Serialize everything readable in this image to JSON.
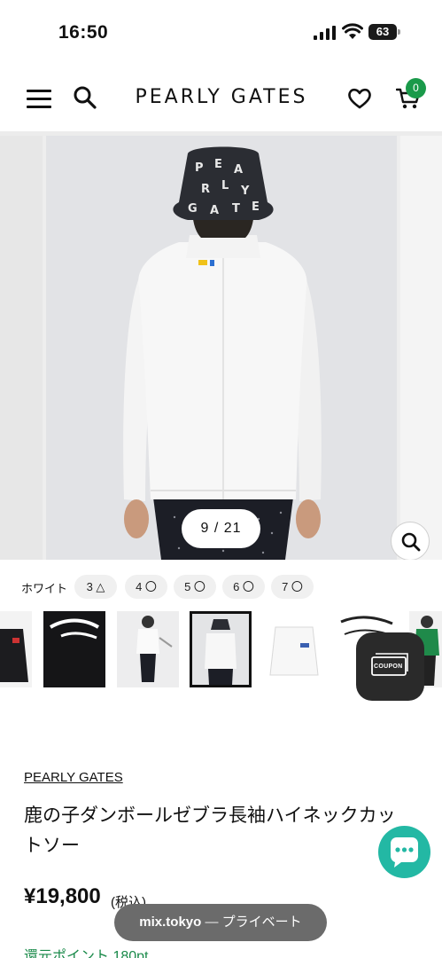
{
  "status_bar": {
    "time": "16:50",
    "battery": "63",
    "icons": [
      "signal-icon",
      "wifi-icon",
      "battery-icon"
    ]
  },
  "header": {
    "logo": "PEARLY GATES",
    "cart_count": "0",
    "icons": [
      "menu-icon",
      "search-icon",
      "heart-icon",
      "cart-icon"
    ]
  },
  "gallery": {
    "current": "9",
    "separator": "/",
    "total": "21",
    "zoom_icon": "search-icon"
  },
  "variant": {
    "color": "ホワイト",
    "sizes": [
      {
        "label": "3",
        "stock": "△"
      },
      {
        "label": "4",
        "stock": "〇"
      },
      {
        "label": "5",
        "stock": "〇"
      },
      {
        "label": "6",
        "stock": "〇"
      },
      {
        "label": "7",
        "stock": "〇"
      }
    ]
  },
  "coupon": {
    "label": "COUPON"
  },
  "product": {
    "brand": "PEARLY GATES",
    "title": "鹿の子ダンボールゼブラ長袖ハイネックカットソー",
    "price": "¥19,800",
    "tax": "(税込)",
    "points": "還元ポイント 180pt"
  },
  "browser": {
    "domain": "mix.tokyo",
    "separator": "—",
    "mode": "プライベート"
  },
  "colors": {
    "accent_green": "#1a9a4a",
    "chat_teal": "#23b8a4",
    "coupon_dark": "#2a2a2a"
  }
}
